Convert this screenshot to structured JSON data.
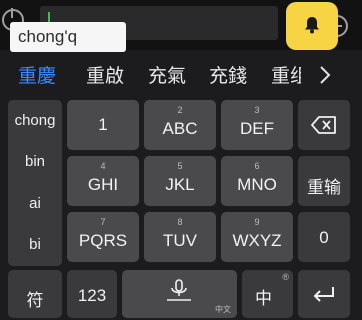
{
  "input": {
    "pinyin": "chong'q"
  },
  "candidates": {
    "items": [
      "重慶",
      "重啟",
      "充氣",
      "充錢",
      "重组"
    ]
  },
  "keyboard": {
    "syllables": [
      "chong",
      "bin",
      "ai",
      "bi"
    ],
    "keys": [
      {
        "num": "",
        "label": "1"
      },
      {
        "num": "2",
        "label": "ABC"
      },
      {
        "num": "3",
        "label": "DEF"
      },
      {
        "num": "4",
        "label": "GHI"
      },
      {
        "num": "5",
        "label": "JKL"
      },
      {
        "num": "6",
        "label": "MNO"
      },
      {
        "num": "7",
        "label": "PQRS"
      },
      {
        "num": "8",
        "label": "TUV"
      },
      {
        "num": "9",
        "label": "WXYZ"
      }
    ],
    "reinput": "重输",
    "zero": "0",
    "symbol": "符",
    "num123": "123",
    "space_hint": "中文",
    "lang": "中",
    "lang_badge": "®"
  }
}
